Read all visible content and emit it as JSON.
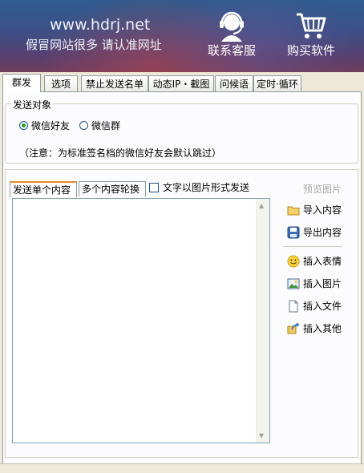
{
  "banner": {
    "site_url": "www.hdrj.net",
    "warning": "假冒网站很多 请认准网址",
    "service_label": "联系客服",
    "buy_label": "购买软件"
  },
  "tabs": [
    "群发",
    "选项",
    "禁止发送名单",
    "动态IP・截图",
    "问候语",
    "定时·循环"
  ],
  "send_target": {
    "title": "发送对象",
    "options": [
      "微信好友",
      "微信群"
    ],
    "selected": "微信好友",
    "note": "（注意：为标准签名档的微信好友会默认跳过）"
  },
  "content": {
    "subtabs": [
      "发送单个内容",
      "多个内容轮换"
    ],
    "active_subtab": "发送单个内容",
    "text_as_image_label": "文字以图片形式发送",
    "text_as_image_checked": false,
    "editor_value": "",
    "preview_label": "预览图片",
    "import_label": "导入内容",
    "export_label": "导出内容",
    "insert_emoji_label": "插入表情",
    "insert_image_label": "插入图片",
    "insert_file_label": "插入文件",
    "insert_other_label": "插入其他"
  },
  "icons": [
    "headset-icon",
    "cart-icon",
    "folder-icon",
    "save-icon",
    "smiley-icon",
    "image-icon",
    "file-icon",
    "share-icon"
  ]
}
